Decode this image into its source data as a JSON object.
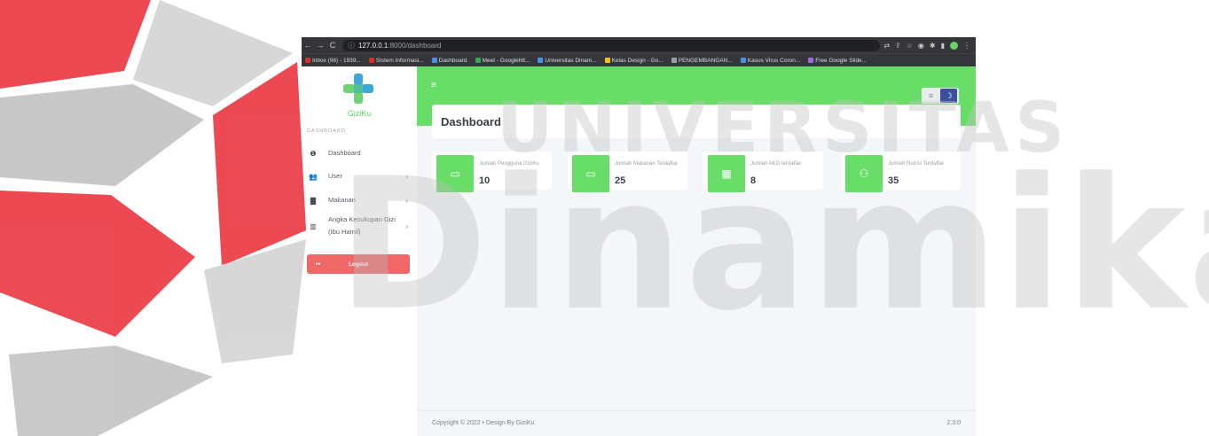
{
  "browser": {
    "url_host": "127.0.0.1",
    "url_path": ":8000/dashboard",
    "bookmarks": [
      {
        "label": "Inbox (96) - 1939...",
        "color": "#d93025"
      },
      {
        "label": "Sistem Informasi...",
        "color": "#d93025"
      },
      {
        "label": "Dashboard",
        "color": "#4a90e2"
      },
      {
        "label": "Meet - Googlehtt...",
        "color": "#34a853"
      },
      {
        "label": "Universitas Dinam...",
        "color": "#4a90e2"
      },
      {
        "label": "Kelas Design - Go...",
        "color": "#fbbc05"
      },
      {
        "label": "PENGEMBANGAN...",
        "color": "#9aa0a6"
      },
      {
        "label": "Kasus Virus Coron...",
        "color": "#4a90e2"
      },
      {
        "label": "Free Google Slide...",
        "color": "#9c6ade"
      }
    ]
  },
  "app": {
    "brand": "GiziKu",
    "section_label": "DASHBOARD",
    "menu": [
      {
        "label": "Dashboard",
        "icon": "info-circle-icon",
        "glyph": "❶",
        "has_chevron": false
      },
      {
        "label": "User",
        "icon": "users-icon",
        "glyph": "👥",
        "has_chevron": true
      },
      {
        "label": "Makanan",
        "icon": "book-icon",
        "glyph": "▇",
        "has_chevron": true
      },
      {
        "label": "Angka Kecukupan Gizi (Ibu Hamil)",
        "icon": "book-open-icon",
        "glyph": "▥",
        "has_chevron": true
      }
    ],
    "logout_label": "Logout",
    "page_title": "Dashboard",
    "stats": [
      {
        "label": "Jumlah Pengguna GiziKu",
        "value": "10",
        "icon": "id-card-icon",
        "glyph": "▭"
      },
      {
        "label": "Jumlah Makanan Terdaftar",
        "value": "25",
        "icon": "id-card-icon",
        "glyph": "▭"
      },
      {
        "label": "Jumlah AKG terdaftar",
        "value": "8",
        "icon": "boxes-icon",
        "glyph": "▦"
      },
      {
        "label": "Jumlah Nutrisi Terdaftar",
        "value": "35",
        "icon": "people-icon",
        "glyph": "⚇"
      }
    ],
    "footer_copyright": "Copyright © 2022  •  Design By GiziKu",
    "footer_version": "2.3.0"
  },
  "watermark": {
    "line1": "UNIVERSITAS",
    "line2": "Dinamika",
    "colors": {
      "red": "#e8222e",
      "gray": "#bfbfbf"
    }
  },
  "theme": {
    "accent": "#68dd68",
    "danger": "#ef6767",
    "toggle_active": "#3b4f9c"
  }
}
